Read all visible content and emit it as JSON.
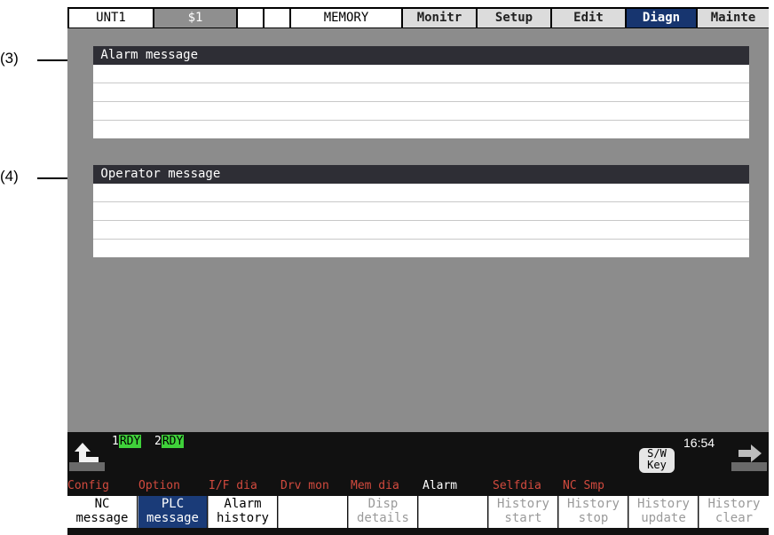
{
  "callouts": {
    "c3": "(3)",
    "c4": "(4)"
  },
  "topbar": {
    "unit": "UNT1",
    "system": "$1",
    "mode": "MEMORY",
    "menus": [
      "Monitr",
      "Setup",
      "Edit",
      "Diagn",
      "Mainte"
    ],
    "active_menu": "Diagn"
  },
  "alarm_panel": {
    "title": " Alarm message"
  },
  "operator_panel": {
    "title": " Operator message"
  },
  "status": {
    "axis1_num": "1",
    "axis1_state": "RDY",
    "axis2_num": "2",
    "axis2_state": "RDY",
    "sw_key": "S/W Key",
    "time": "16:54"
  },
  "menu_row": [
    "Config",
    "Option",
    "I/F dia",
    "Drv mon",
    "Mem dia",
    "Alarm",
    "Selfdia",
    "NC Smp"
  ],
  "menu_row_selected": "Alarm",
  "function_keys": [
    {
      "l1": "NC",
      "l2": "message",
      "state": "normal"
    },
    {
      "l1": "PLC",
      "l2": "message",
      "state": "selected"
    },
    {
      "l1": "Alarm",
      "l2": "history",
      "state": "normal"
    },
    {
      "l1": "",
      "l2": "",
      "state": "normal"
    },
    {
      "l1": "Disp",
      "l2": "details",
      "state": "disabled"
    },
    {
      "l1": "",
      "l2": "",
      "state": "normal"
    },
    {
      "l1": "History",
      "l2": "start",
      "state": "disabled"
    },
    {
      "l1": "History",
      "l2": "stop",
      "state": "disabled"
    },
    {
      "l1": "History",
      "l2": "update",
      "state": "disabled"
    },
    {
      "l1": "History",
      "l2": "clear",
      "state": "disabled"
    }
  ],
  "colors": {
    "accent": "#17356f",
    "ready": "#3fd13a",
    "menu_text": "#d24a3e"
  },
  "icons": {
    "back": "back-arrow-icon",
    "next": "next-arrow-icon"
  }
}
